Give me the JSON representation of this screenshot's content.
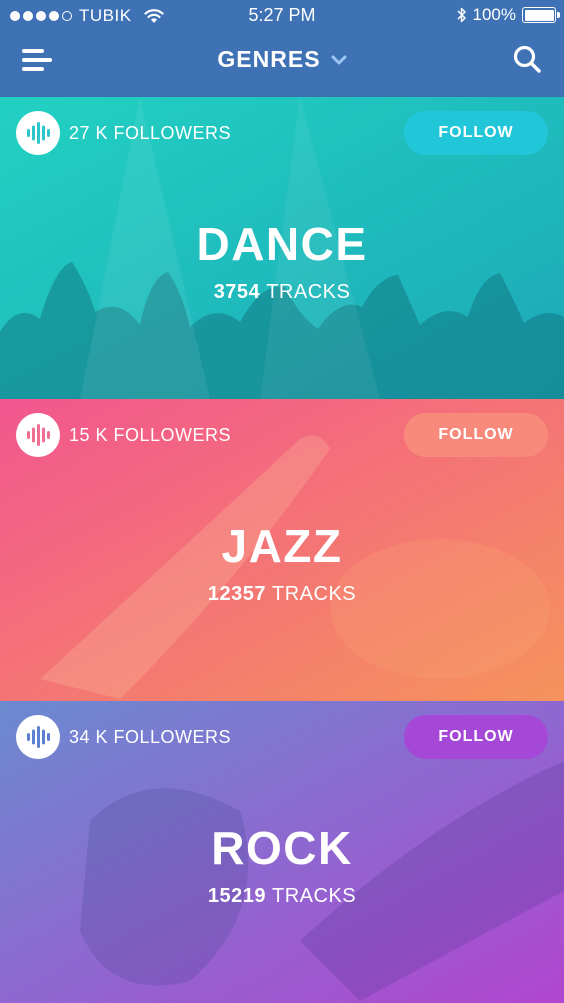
{
  "status_bar": {
    "carrier": "TUBIK",
    "time": "5:27 PM",
    "battery": "100%",
    "battery_level": 1.0,
    "signal_bars": 4
  },
  "nav": {
    "title": "GENRES",
    "menu_icon": "hamburger-menu-icon",
    "dropdown_icon": "chevron-down-icon",
    "search_icon": "search-icon",
    "bar_color": "#3f72b4"
  },
  "genres": [
    {
      "name": "DANCE",
      "followers": "27 K FOLLOWERS",
      "follow_label": "FOLLOW",
      "track_count": "3754",
      "track_word": "TRACKS",
      "gradient": [
        "#22d1c2",
        "#1ca7b8"
      ],
      "button_color": "#21c6d8",
      "badge_color": "#2cc5c9"
    },
    {
      "name": "JAZZ",
      "followers": "15 K FOLLOWERS",
      "follow_label": "FOLLOW",
      "track_count": "12357",
      "track_word": "TRACKS",
      "gradient": [
        "#f2568f",
        "#f6935c"
      ],
      "button_color": "#f88a7c",
      "badge_color": "#f06e92"
    },
    {
      "name": "ROCK",
      "followers": "34 K FOLLOWERS",
      "follow_label": "FOLLOW",
      "track_count": "15219",
      "track_word": "TRACKS",
      "gradient": [
        "#6b8ad0",
        "#b146cf"
      ],
      "button_color": "#a548d8",
      "badge_color": "#5d7fd2"
    }
  ]
}
